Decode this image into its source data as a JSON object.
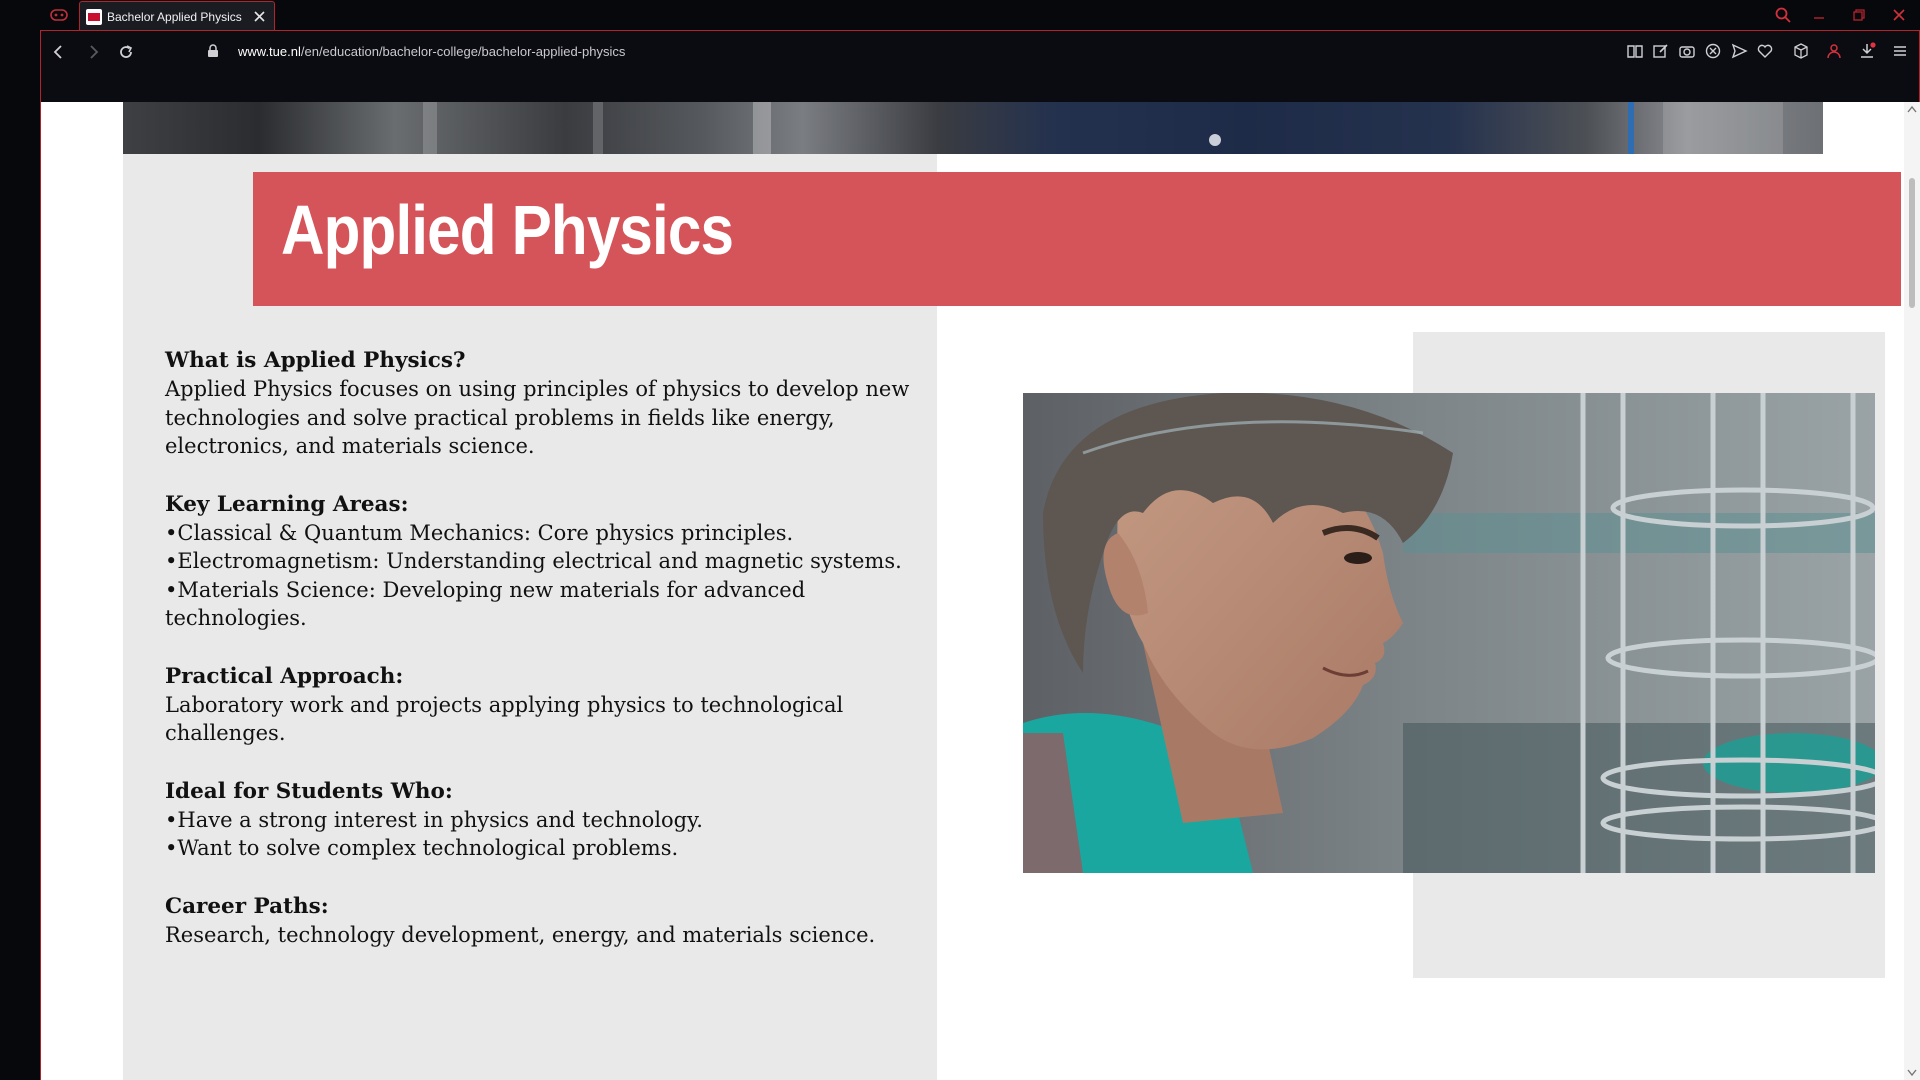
{
  "browser": {
    "tab_title": "Bachelor Applied Physics",
    "url_domain": "www.tue.nl",
    "url_path": "/en/education/bachelor-college/bachelor-applied-physics",
    "accent_color": "#b3232e"
  },
  "page": {
    "title": "Applied Physics",
    "title_band_color": "#d45459",
    "sections": [
      {
        "heading": "What is Applied Physics?",
        "lines": [
          "Applied Physics focuses on using principles of physics to develop new technologies and solve practical problems in fields like energy, electronics, and materials science."
        ]
      },
      {
        "heading": "Key Learning Areas:",
        "lines": [
          "•Classical & Quantum Mechanics: Core physics principles.",
          "•Electromagnetism: Understanding electrical and magnetic systems.",
          "•Materials Science: Developing new materials for advanced technologies."
        ]
      },
      {
        "heading": "Practical Approach:",
        "lines": [
          "Laboratory work and projects applying physics to technological challenges."
        ]
      },
      {
        "heading": "Ideal for Students Who:",
        "lines": [
          "•Have a strong interest in physics and technology.",
          "•Want to solve complex technological problems."
        ]
      },
      {
        "heading": "Career Paths:",
        "lines": [
          "Research, technology development, energy, and materials science."
        ]
      }
    ]
  },
  "icons": {
    "tab_bar": [
      "gamepad-icon",
      "close-icon"
    ],
    "window": [
      "search-icon",
      "minimize-icon",
      "restore-icon",
      "close-window-icon"
    ],
    "toolbar": [
      "back-icon",
      "forward-icon",
      "reload-icon",
      "lock-icon",
      "reader-mode-icon",
      "edit-icon",
      "camera-icon",
      "adblock-icon",
      "send-icon",
      "heart-icon",
      "box-icon",
      "profile-icon",
      "download-icon",
      "menu-icon"
    ]
  }
}
